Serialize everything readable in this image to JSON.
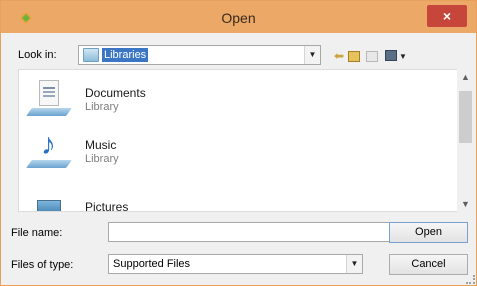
{
  "window": {
    "title": "Open",
    "close_glyph": "×"
  },
  "look_in": {
    "label": "Look in:",
    "value": "Libraries",
    "icon": "libraries-folder-icon"
  },
  "toolbar": {
    "icons": [
      "back-icon",
      "up-folder-icon",
      "new-folder-icon",
      "views-menu-icon"
    ]
  },
  "items": [
    {
      "name": "Documents",
      "type": "Library",
      "icon": "documents-library-icon"
    },
    {
      "name": "Music",
      "type": "Library",
      "icon": "music-library-icon"
    },
    {
      "name": "Pictures",
      "type": "",
      "icon": "pictures-library-icon"
    }
  ],
  "file_name": {
    "label": "File name:",
    "value": ""
  },
  "file_type": {
    "label": "Files of type:",
    "value": "Supported Files"
  },
  "buttons": {
    "open": "Open",
    "cancel": "Cancel"
  },
  "colors": {
    "titlebar": "#eba867",
    "close": "#c7463b",
    "selection": "#3a76c4"
  }
}
